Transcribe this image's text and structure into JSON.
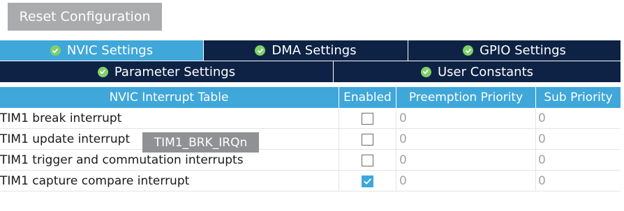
{
  "toolbar": {
    "reset_label": "Reset Configuration"
  },
  "tabs": [
    {
      "label": "NVIC Settings",
      "active": true,
      "icon": "check-circle-icon"
    },
    {
      "label": "DMA Settings",
      "active": false,
      "icon": "check-circle-icon"
    },
    {
      "label": "GPIO Settings",
      "active": false,
      "icon": "check-circle-icon"
    },
    {
      "label": "Parameter Settings",
      "active": false,
      "icon": "check-circle-icon"
    },
    {
      "label": "User Constants",
      "active": false,
      "icon": "check-circle-icon"
    }
  ],
  "table": {
    "headers": [
      "NVIC Interrupt Table",
      "Enabled",
      "Preemption Priority",
      "Sub Priority"
    ],
    "rows": [
      {
        "name": "TIM1 break interrupt",
        "enabled": false,
        "preemption": "0",
        "sub": "0"
      },
      {
        "name": "TIM1 update interrupt",
        "enabled": false,
        "preemption": "0",
        "sub": "0"
      },
      {
        "name": "TIM1 trigger and commutation interrupts",
        "enabled": false,
        "preemption": "0",
        "sub": "0"
      },
      {
        "name": "TIM1 capture compare interrupt",
        "enabled": true,
        "preemption": "0",
        "sub": "0"
      }
    ]
  },
  "tooltip": {
    "text": "TIM1_BRK_IRQn"
  },
  "colors": {
    "accent": "#3fa7d9",
    "tab_dark": "#0d2244",
    "button_gray": "#a9abad",
    "ok_green": "#7ed06a",
    "tooltip_gray": "#8f9194"
  }
}
